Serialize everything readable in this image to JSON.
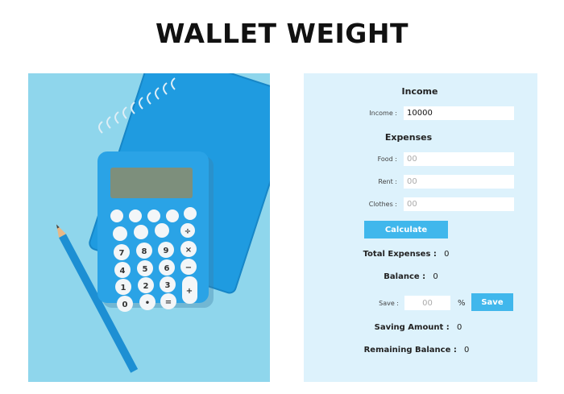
{
  "header": {
    "title": "WALLET WEIGHT"
  },
  "illustration": {
    "icon": "calculator-notebook-pencil-image",
    "bg_color": "#8fd6ec",
    "accent_color": "#1e96d8"
  },
  "form": {
    "income_heading": "Income",
    "income_label": "Income :",
    "income_value": "10000",
    "expenses_heading": "Expenses",
    "food_label": "Food :",
    "food_placeholder": "00",
    "rent_label": "Rent :",
    "rent_placeholder": "00",
    "clothes_label": "Clothes :",
    "clothes_placeholder": "00",
    "calculate_label": "Calculate",
    "total_expenses_label": "Total Expenses :",
    "total_expenses_value": "0",
    "balance_label": "Balance :",
    "balance_value": "0",
    "save_label": "Save :",
    "save_placeholder": "00",
    "percent_symbol": "%",
    "save_button_label": "Save",
    "saving_amount_label": "Saving Amount :",
    "saving_amount_value": "0",
    "remaining_balance_label": "Remaining Balance :",
    "remaining_balance_value": "0"
  },
  "colors": {
    "panel_bg": "#ddf2fc",
    "button_bg": "#40b7ec"
  }
}
